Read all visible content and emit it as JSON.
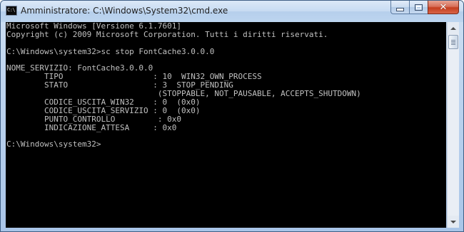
{
  "window": {
    "title": "Amministratore: C:\\Windows\\System32\\cmd.exe",
    "icon_label": "C:\\",
    "icon": "cmd-icon",
    "controls": {
      "minimize_icon": "minimize-icon",
      "maximize_icon": "maximize-icon",
      "close_icon": "close-icon",
      "close_glyph": "✕"
    }
  },
  "console": {
    "lines": [
      "Microsoft Windows [Versione 6.1.7601]",
      "Copyright (c) 2009 Microsoft Corporation. Tutti i diritti riservati.",
      "",
      "C:\\Windows\\system32>sc stop FontCache3.0.0.0",
      "",
      "NOME_SERVIZIO: FontCache3.0.0.0",
      "        TIPO                   : 10  WIN32_OWN_PROCESS",
      "        STATO                  : 3  STOP_PENDING",
      "                                (STOPPABLE, NOT_PAUSABLE, ACCEPTS_SHUTDOWN)",
      "        CODICE_USCITA_WIN32    : 0  (0x0)",
      "        CODICE_USCITA_SERVIZIO : 0  (0x0)",
      "        PUNTO_CONTROLLO         : 0x0",
      "        INDICAZIONE_ATTESA     : 0x0",
      "",
      "C:\\Windows\\system32>"
    ]
  },
  "colors": {
    "console_background": "#000000",
    "console_text": "#c0c0c0",
    "close_button": "#c43e1f"
  }
}
